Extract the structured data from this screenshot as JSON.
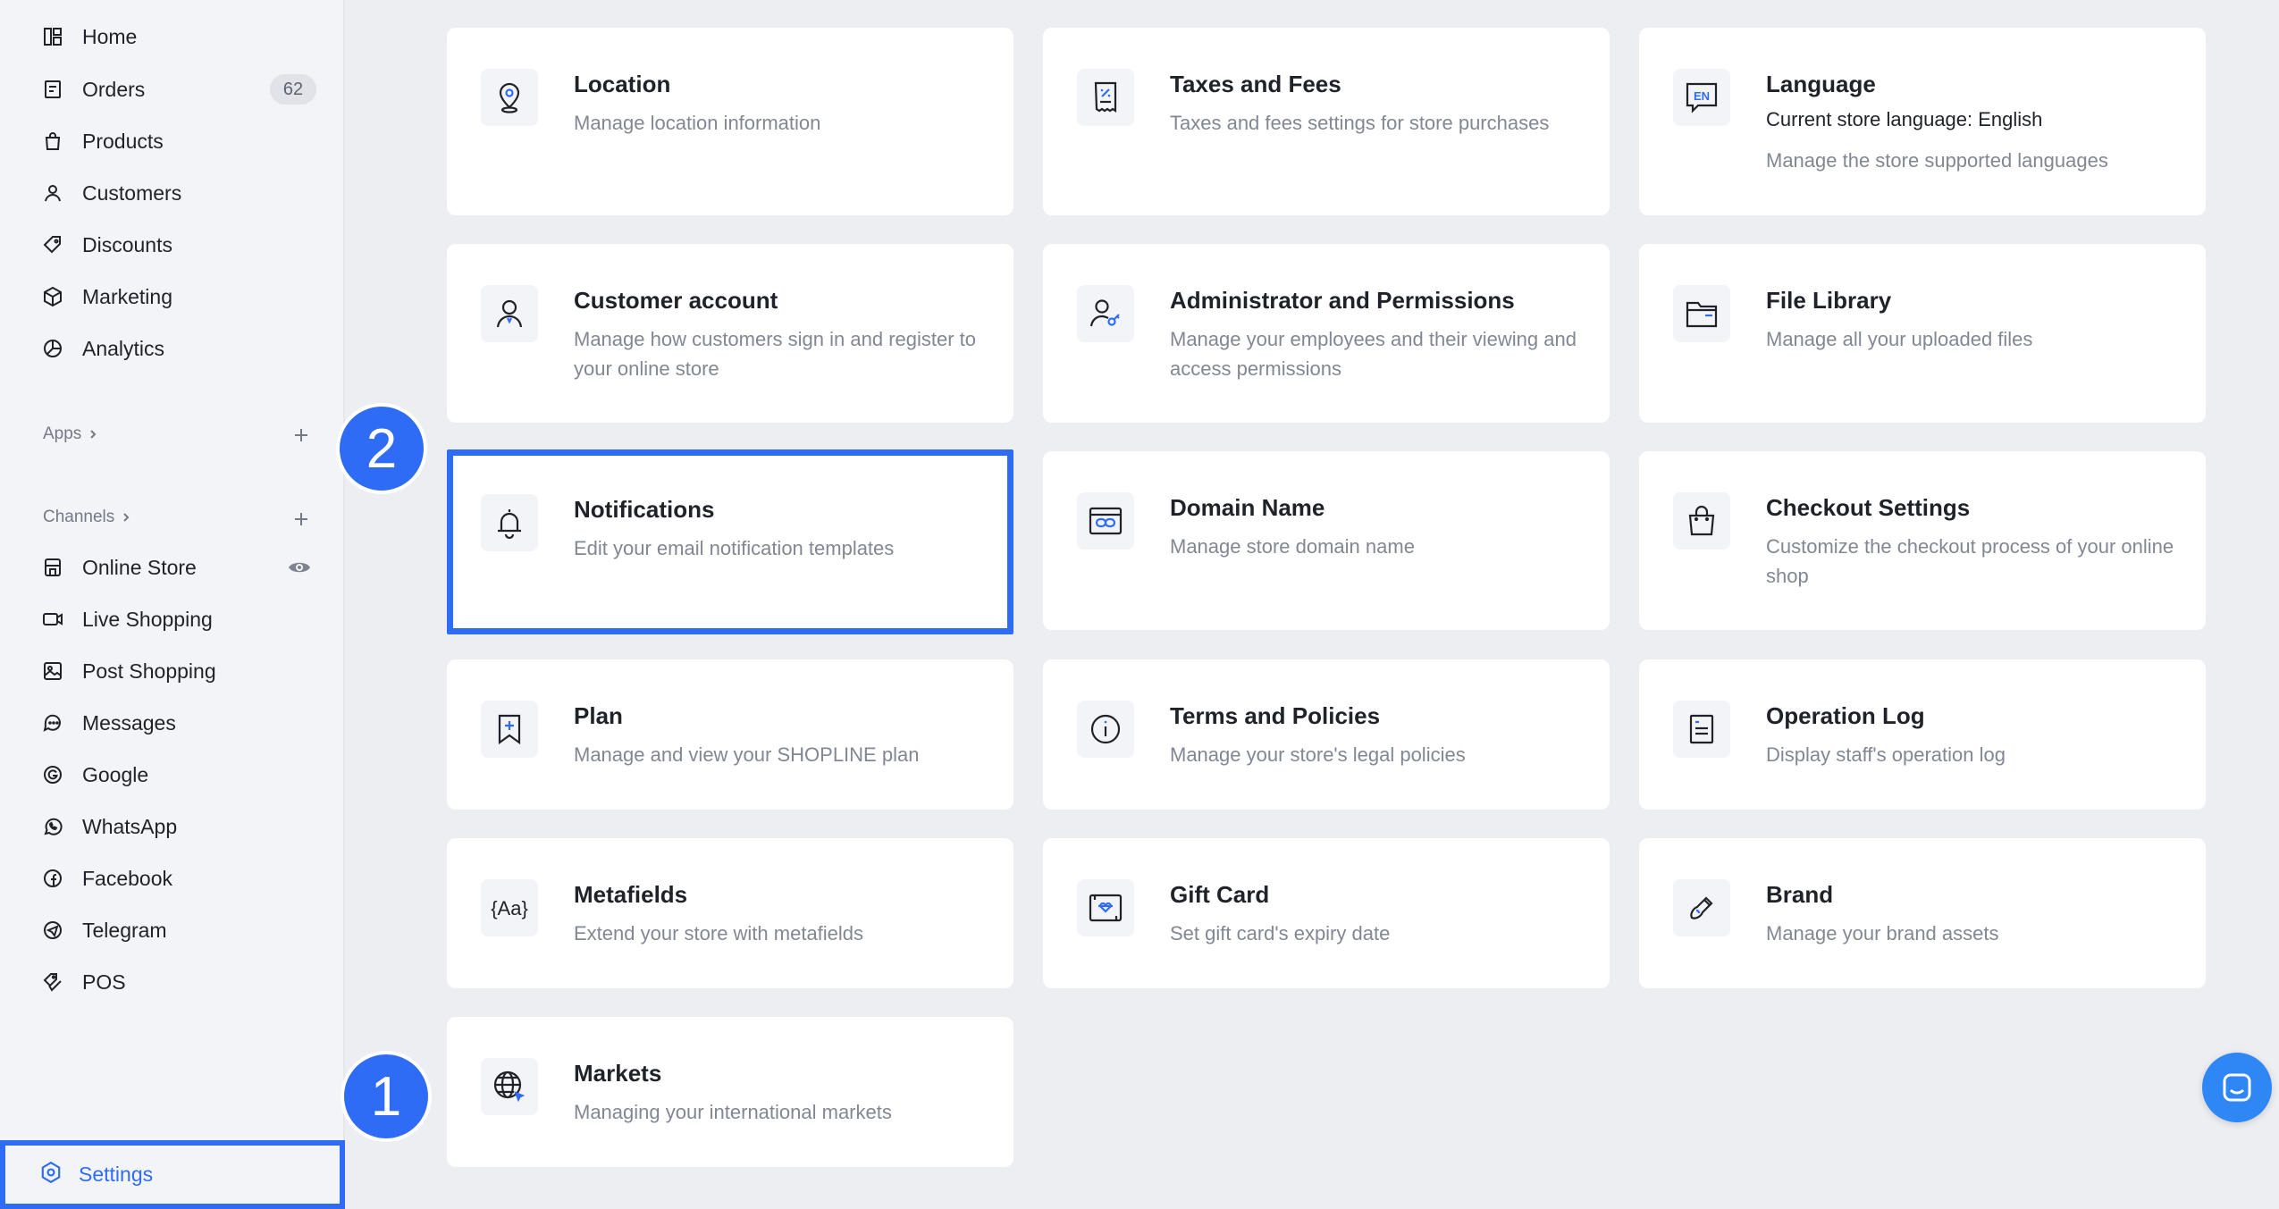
{
  "sidebar": {
    "nav": [
      {
        "label": "Home",
        "icon": "home-icon"
      },
      {
        "label": "Orders",
        "icon": "orders-icon",
        "badge": "62"
      },
      {
        "label": "Products",
        "icon": "products-icon"
      },
      {
        "label": "Customers",
        "icon": "customers-icon"
      },
      {
        "label": "Discounts",
        "icon": "discounts-icon"
      },
      {
        "label": "Marketing",
        "icon": "marketing-icon"
      },
      {
        "label": "Analytics",
        "icon": "analytics-icon"
      }
    ],
    "apps_label": "Apps",
    "channels_label": "Channels",
    "channels": [
      {
        "label": "Online Store",
        "icon": "store-icon"
      },
      {
        "label": "Live Shopping",
        "icon": "live-shopping-icon"
      },
      {
        "label": "Post Shopping",
        "icon": "post-shopping-icon"
      },
      {
        "label": "Messages",
        "icon": "messages-icon"
      },
      {
        "label": "Google",
        "icon": "google-icon"
      },
      {
        "label": "WhatsApp",
        "icon": "whatsapp-icon"
      },
      {
        "label": "Facebook",
        "icon": "facebook-icon"
      },
      {
        "label": "Telegram",
        "icon": "telegram-icon"
      },
      {
        "label": "POS",
        "icon": "pos-icon"
      }
    ],
    "settings_label": "Settings"
  },
  "cards": [
    {
      "title": "Location",
      "desc": "Manage location information",
      "icon": "location-icon"
    },
    {
      "title": "Taxes and Fees",
      "desc": "Taxes and fees settings for store purchases",
      "icon": "receipt-icon"
    },
    {
      "title": "Language",
      "subtitle": "Current store language: English",
      "desc": "Manage the store supported languages",
      "icon": "language-icon",
      "icon_text": "EN"
    },
    {
      "title": "Customer account",
      "desc": "Manage how customers sign in and register to your online store",
      "icon": "customer-account-icon"
    },
    {
      "title": "Administrator and Permissions",
      "desc": "Manage your employees and their viewing and access permissions",
      "icon": "admin-key-icon"
    },
    {
      "title": "File Library",
      "desc": "Manage all your uploaded files",
      "icon": "folder-icon"
    },
    {
      "title": "Notifications",
      "desc": "Edit your email notification templates",
      "icon": "bell-icon"
    },
    {
      "title": "Domain Name",
      "desc": "Manage store domain name",
      "icon": "domain-link-icon"
    },
    {
      "title": "Checkout Settings",
      "desc": "Customize the checkout process of your online shop",
      "icon": "shopping-bag-icon"
    },
    {
      "title": "Plan",
      "desc": "Manage and view your SHOPLINE plan",
      "icon": "plan-bookmark-icon"
    },
    {
      "title": "Terms and Policies",
      "desc": "Manage your store's legal policies",
      "icon": "info-icon"
    },
    {
      "title": "Operation Log",
      "desc": "Display staff's operation log",
      "icon": "log-clipboard-icon"
    },
    {
      "title": "Metafields",
      "desc": "Extend your store with metafields",
      "icon": "metafields-icon",
      "icon_text": "{Aa}"
    },
    {
      "title": "Gift Card",
      "desc": "Set gift card's expiry date",
      "icon": "gift-card-icon"
    },
    {
      "title": "Brand",
      "desc": "Manage your brand assets",
      "icon": "brand-brush-icon"
    },
    {
      "title": "Markets",
      "desc": "Managing your international markets",
      "icon": "globe-icon"
    }
  ],
  "steps": [
    "1",
    "2"
  ],
  "colors": {
    "accent": "#2f6cf6",
    "chat": "#2f87f6"
  }
}
